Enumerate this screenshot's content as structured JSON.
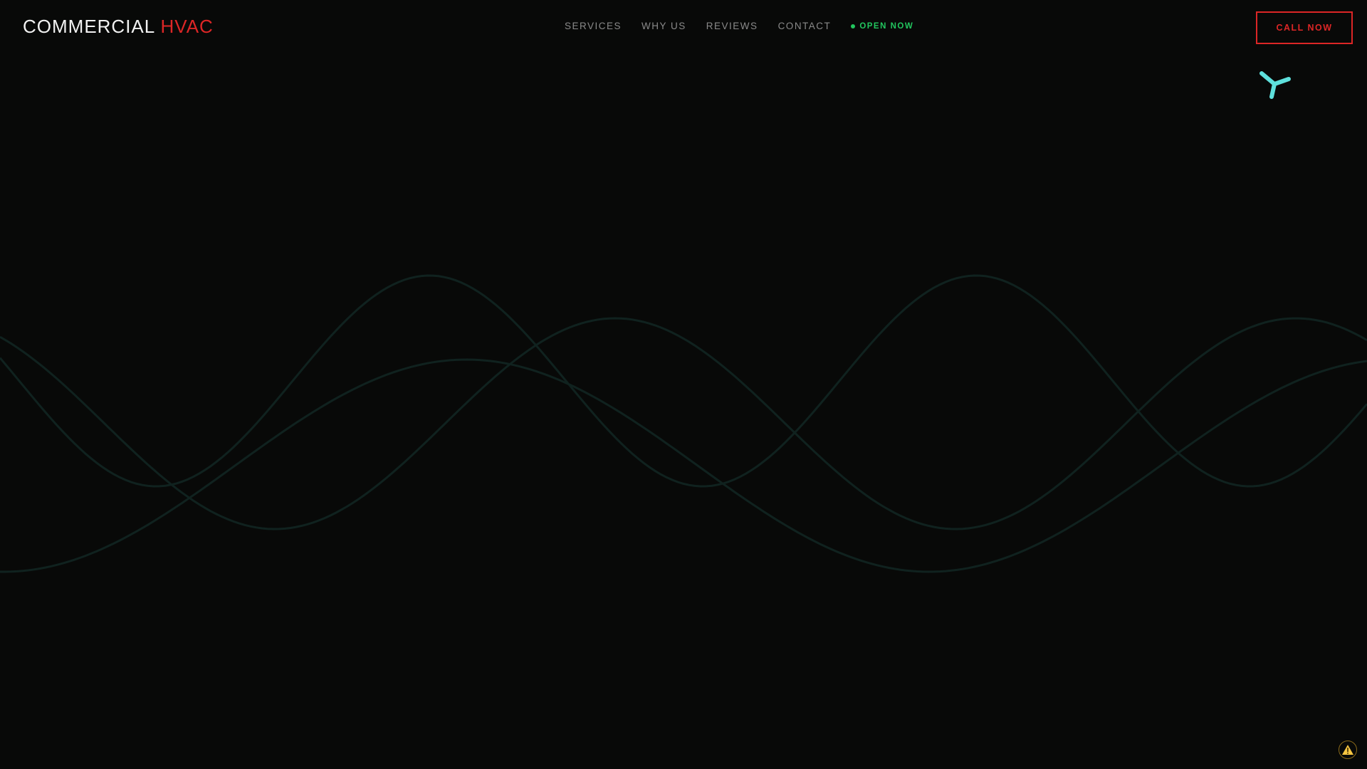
{
  "header": {
    "logo_main": "COMMERCIAL",
    "logo_accent": "HVAC",
    "nav": [
      {
        "label": "SERVICES"
      },
      {
        "label": "WHY US"
      },
      {
        "label": "REVIEWS"
      },
      {
        "label": "CONTACT"
      }
    ],
    "status": "OPEN NOW",
    "cta_label": "CALL NOW"
  },
  "colors": {
    "accent": "#dc2626",
    "status": "#22c55e",
    "fan": "#5ee0dc",
    "wave": "#10221f",
    "warning": "#f5c542"
  }
}
